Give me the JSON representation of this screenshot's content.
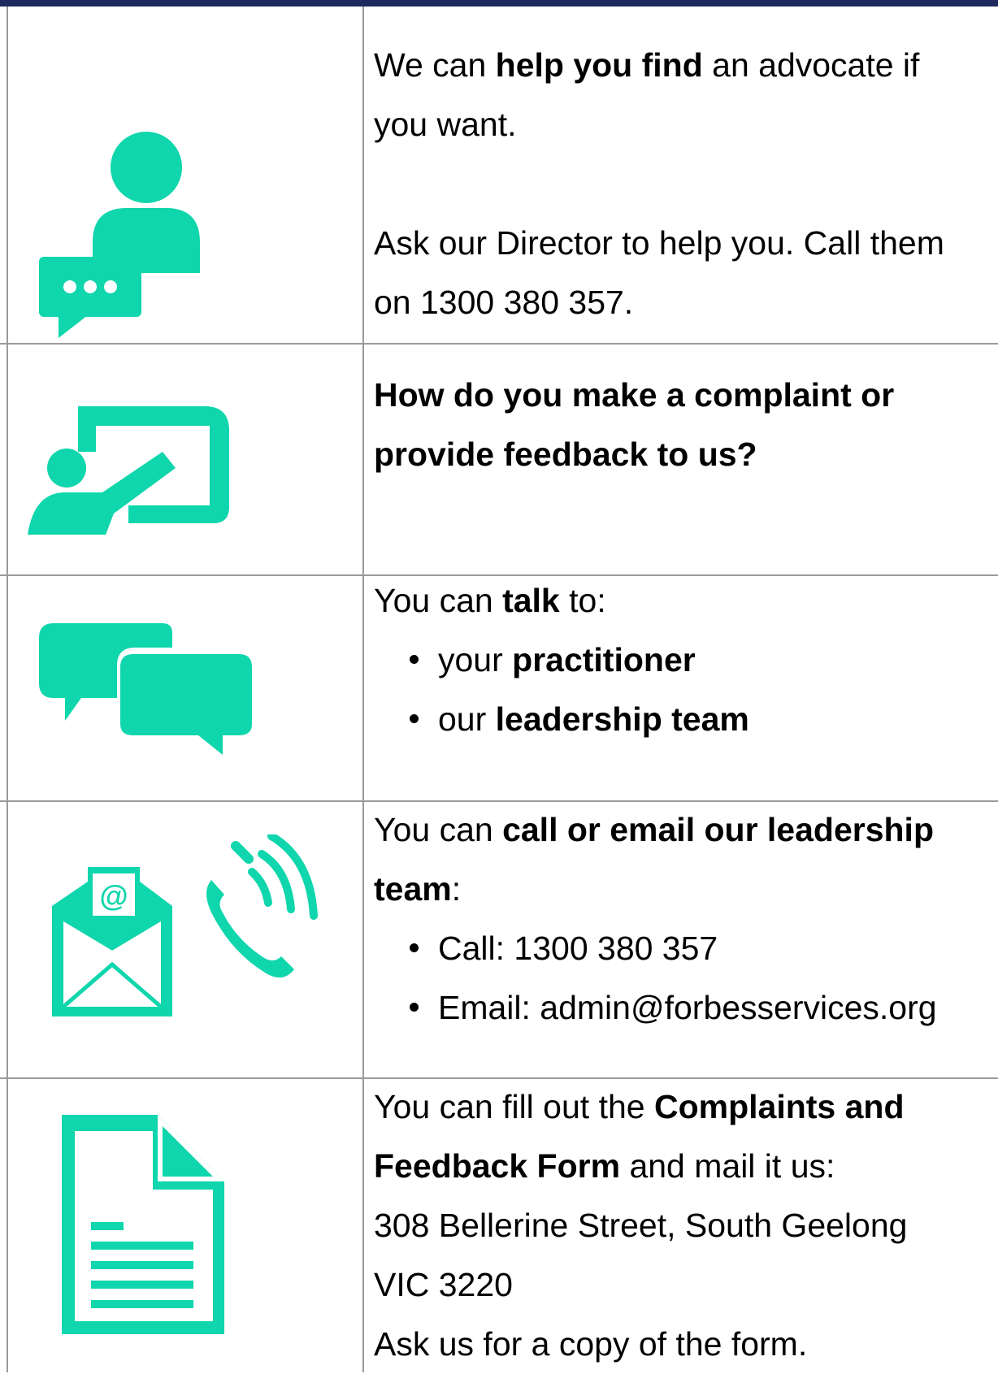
{
  "rows": [
    {
      "icon": "person-with-chat-icon",
      "p1_a": "We can ",
      "p1_b": "help you find",
      "p1_c": " an advocate if",
      "p1_d": "you want.",
      "p2_a": "Ask our Director to help you. Call them",
      "p2_b": "on 1300 380 357."
    },
    {
      "icon": "presenter-whiteboard-icon",
      "heading_1": "How do you make a complaint or",
      "heading_2": "provide feedback to us?"
    },
    {
      "icon": "speech-bubbles-icon",
      "intro_a": "You can ",
      "intro_b": "talk",
      "intro_c": " to:",
      "bullets": [
        {
          "pre": "your ",
          "bold": "practitioner"
        },
        {
          "pre": "our ",
          "bold": "leadership team"
        }
      ]
    },
    {
      "icon": "email-and-phone-icon",
      "intro_a": "You can ",
      "intro_b": "call or email our leadership",
      "intro_c": "team",
      "intro_d": ":",
      "bullets": [
        "Call: 1300 380 357",
        "Email: admin@forbesservices.org"
      ]
    },
    {
      "icon": "document-form-icon",
      "l1_a": "You can fill out the ",
      "l1_b": "Complaints and",
      "l2_a": "Feedback Form",
      "l2_b": " and mail it us:",
      "l3": "308 Bellerine Street, South Geelong",
      "l4": "VIC 3220",
      "l5": "Ask us for a copy of the form."
    }
  ],
  "colors": {
    "accent": "#0fd6ac",
    "border": "#9a9a9a",
    "topbar": "#1f2a5c"
  }
}
